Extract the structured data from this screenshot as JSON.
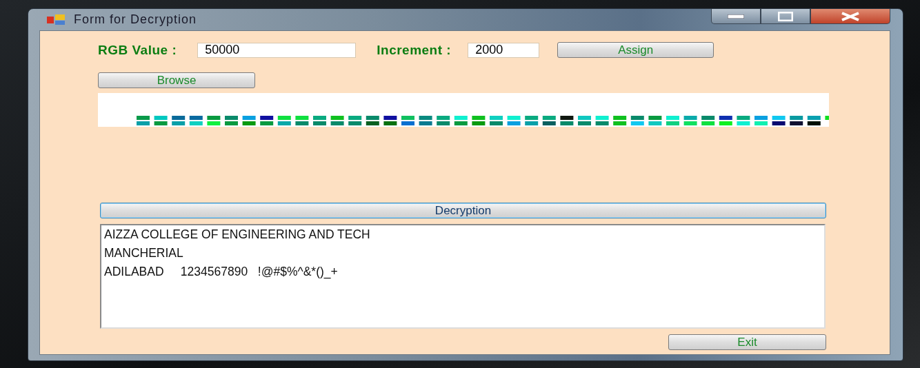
{
  "window": {
    "title": "Form for Decryption"
  },
  "rgb_value": {
    "label": "RGB Value :",
    "value": "50000"
  },
  "increment": {
    "label": "Increment :",
    "value": "2000"
  },
  "buttons": {
    "assign": "Assign",
    "browse": "Browse",
    "decryption": "Decryption",
    "exit": "Exit"
  },
  "output": {
    "lines": [
      "AIZZA COLLEGE OF ENGINEERING AND TECH",
      "MANCHERIAL",
      "ADILABAD     1234567890   !@#$%^&*()_+"
    ]
  }
}
